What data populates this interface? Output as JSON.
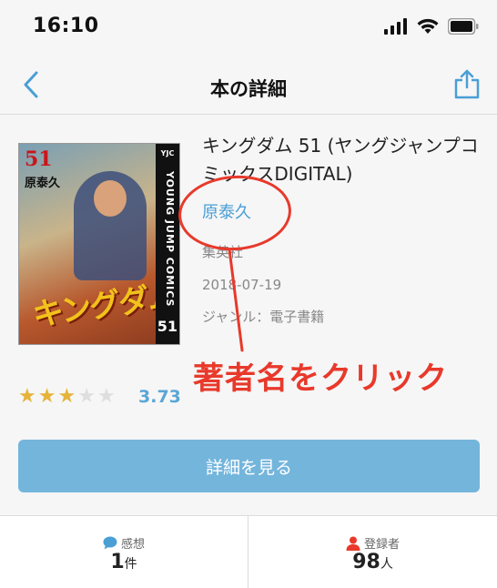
{
  "status_bar": {
    "time": "16:10"
  },
  "nav": {
    "title": "本の詳細"
  },
  "book": {
    "title": "キングダム 51 (ヤングジャンプコミックスDIGITAL)",
    "author": "原泰久",
    "publisher": "集英社",
    "date": "2018-07-19",
    "genre": "ジャンル：電子書籍",
    "cover": {
      "volume": "51",
      "author": "原泰久",
      "series_logo": "キングダム",
      "label": "YJC",
      "spine_text": "YOUNG JUMP COMICS",
      "spine_number": "51"
    }
  },
  "rating": {
    "value": "3.73",
    "stars_filled": 3,
    "stars_total": 5
  },
  "detail_button": {
    "label": "詳細を見る"
  },
  "stats": {
    "impressions": {
      "label": "感想",
      "count": "1",
      "unit": "件"
    },
    "registrants": {
      "label": "登録者",
      "count": "98",
      "unit": "人"
    }
  },
  "annotation": {
    "text": "著者名をクリック"
  },
  "colors": {
    "accent": "#4a9fd5",
    "button": "#74b5dc",
    "annotation": "#e8392b",
    "star": "#e6b33a"
  }
}
